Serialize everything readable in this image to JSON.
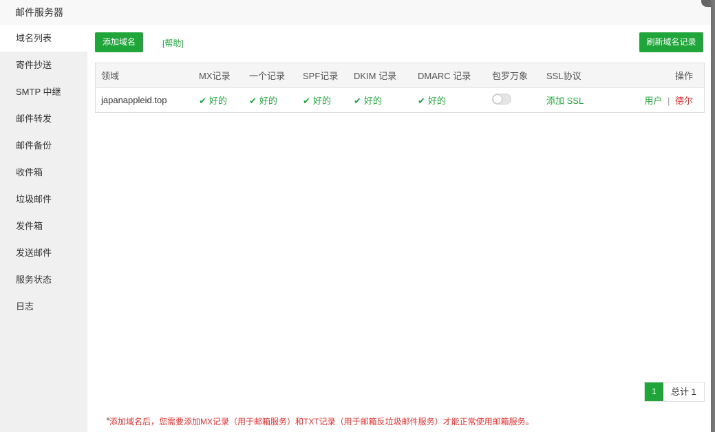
{
  "modal": {
    "title": "邮件服务器"
  },
  "sidebar": {
    "items": [
      {
        "label": "域名列表",
        "active": true
      },
      {
        "label": "寄件抄送"
      },
      {
        "label": "SMTP 中继"
      },
      {
        "label": "邮件转发"
      },
      {
        "label": "邮件备份"
      },
      {
        "label": "收件箱"
      },
      {
        "label": "垃圾邮件"
      },
      {
        "label": "发件箱"
      },
      {
        "label": "发送邮件"
      },
      {
        "label": "服务状态"
      },
      {
        "label": "日志"
      }
    ]
  },
  "toolbar": {
    "add_domain": "添加域名",
    "help": "[帮助]",
    "refresh": "刷新域名记录"
  },
  "table": {
    "headers": [
      "领域",
      "MX记录",
      "一个记录",
      "SPF记录",
      "DKIM 记录",
      "DMARC 记录",
      "包罗万象",
      "SSL协议",
      "操作"
    ],
    "rows": [
      {
        "domain": "japanappleid.top",
        "mx": "好的",
        "a": "好的",
        "spf": "好的",
        "dkim": "好的",
        "dmarc": "好的",
        "catchall_on": false,
        "ssl": "添加 SSL",
        "action_user": "用户",
        "action_sep": "|",
        "action_delete": "德尔"
      }
    ]
  },
  "pagination": {
    "page": "1",
    "total": "总计 1"
  },
  "note": "添加域名后，您需要添加MX记录（用于邮箱服务）和TXT记录（用于邮箱反垃圾邮件服务）才能正常使用邮箱服务。",
  "colors": {
    "accent": "#20a53a",
    "danger": "#e02e2e"
  }
}
